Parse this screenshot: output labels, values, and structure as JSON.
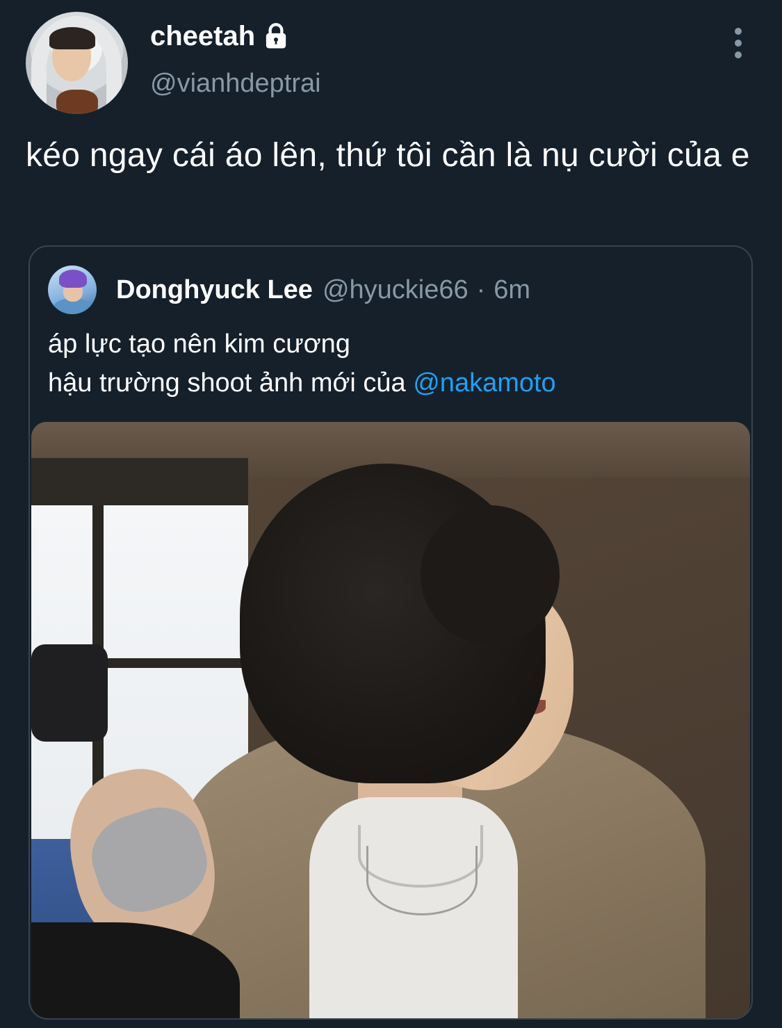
{
  "author": {
    "display_name": "cheetah",
    "handle": "@vianhdeptrai",
    "protected_icon": "lock-icon"
  },
  "tweet": {
    "text": "kéo ngay cái áo lên, thứ tôi cần là nụ cười của e"
  },
  "quoted": {
    "display_name": "Donghyuck Lee",
    "handle": "@hyuckie66",
    "separator": "·",
    "time": "6m",
    "line1": "áp lực tạo nên kim cương",
    "line2_prefix": "hậu trường shoot ảnh mới của ",
    "mention": "@nakamoto"
  },
  "icons": {
    "more": "more-vertical-icon",
    "lock": "lock-icon"
  },
  "colors": {
    "background": "#15202b",
    "secondary_text": "#8899a6",
    "link": "#1da1f2",
    "border": "#38444d"
  }
}
